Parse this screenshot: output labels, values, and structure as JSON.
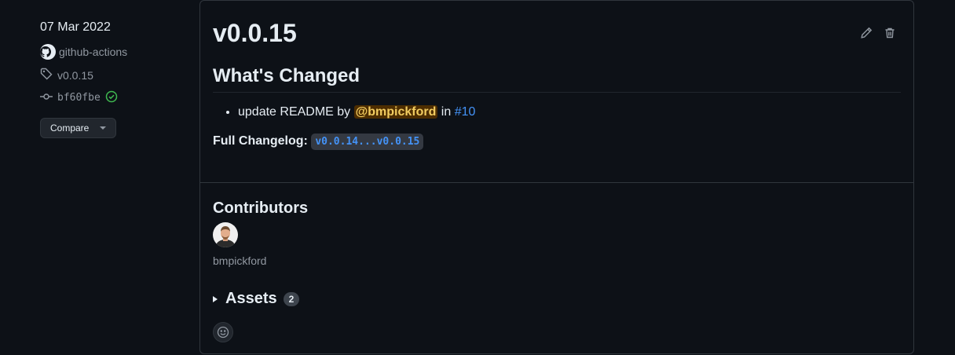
{
  "sidebar": {
    "date": "07 Mar 2022",
    "author": "github-actions",
    "tag": "v0.0.15",
    "commit": "bf60fbe",
    "compare_label": "Compare"
  },
  "release": {
    "title": "v0.0.15",
    "heading": "What's Changed",
    "changes": [
      {
        "text_before": "update README by ",
        "mention": "@bmpickford",
        "text_mid": " in ",
        "pr": "#10"
      }
    ],
    "changelog_label": "Full Changelog:",
    "changelog_range": "v0.0.14...v0.0.15"
  },
  "contributors": {
    "heading": "Contributors",
    "names": [
      "bmpickford"
    ]
  },
  "assets": {
    "label": "Assets",
    "count": "2"
  },
  "colors": {
    "background": "#0d1117",
    "border": "#30363d",
    "link": "#4493f8",
    "mention_bg": "#4d2d00",
    "mention_fg": "#f2cc60",
    "success": "#3fb950"
  },
  "icons": {
    "tag": "tag-icon",
    "commit": "git-commit-icon",
    "verified": "check-circle-icon",
    "edit": "pencil-icon",
    "delete": "trash-icon",
    "reaction": "smiley-icon"
  }
}
